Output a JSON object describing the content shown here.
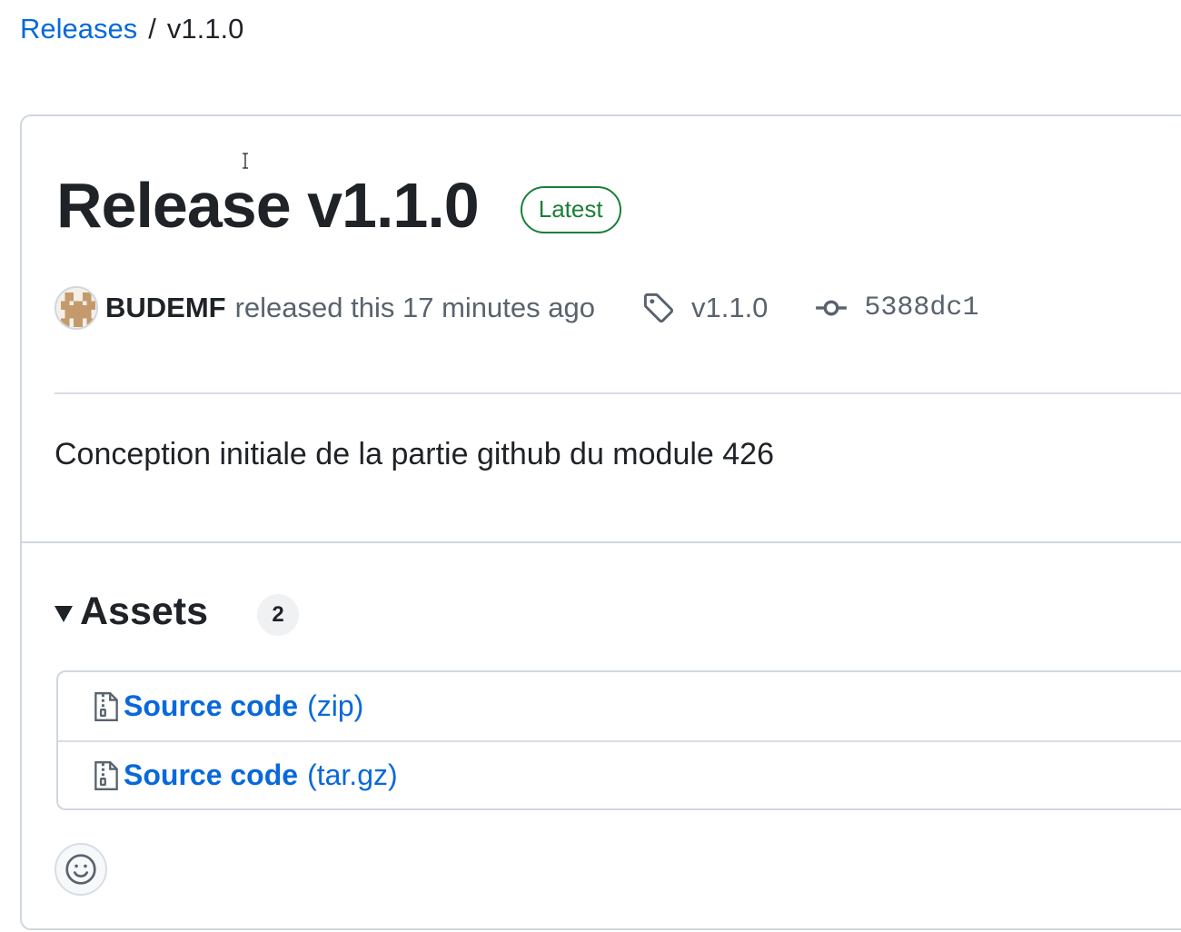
{
  "breadcrumb": {
    "parent": "Releases",
    "separator": "/",
    "current": "v1.1.0"
  },
  "release": {
    "title": "Release v1.1.0",
    "badge": "Latest",
    "author": "BUDEMF",
    "released_text": "released this 17 minutes ago",
    "tag": "v1.1.0",
    "commit": "5388dc1",
    "body": "Conception initiale de la partie github du module 426"
  },
  "assets": {
    "title": "Assets",
    "count": "2",
    "items": [
      {
        "name": "Source code",
        "ext": "(zip)",
        "icon": "file-zip-icon"
      },
      {
        "name": "Source code",
        "ext": "(tar.gz)",
        "icon": "file-zip-icon"
      }
    ]
  },
  "reaction": {
    "icon": "smiley-icon"
  },
  "colors": {
    "link": "#0969da",
    "latest_green": "#1a7f37",
    "muted": "#59636e",
    "border": "#d0d7de",
    "text": "#1f2328"
  }
}
